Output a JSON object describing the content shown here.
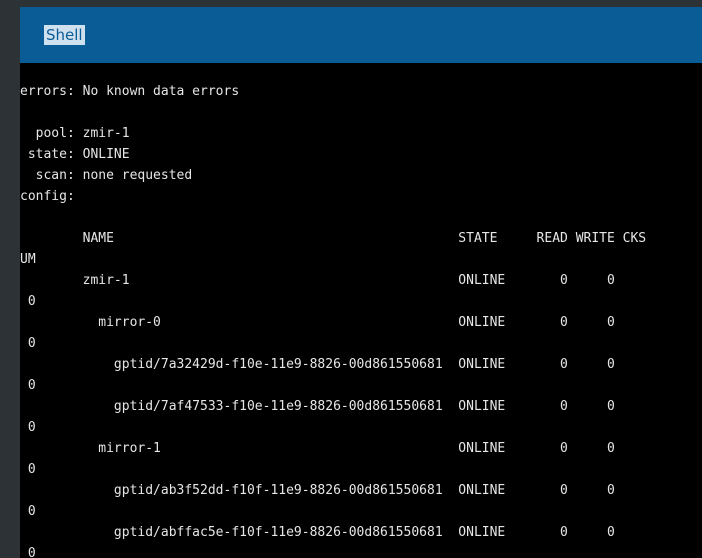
{
  "header": {
    "title": "Shell"
  },
  "terminal": {
    "lines": [
      "errors: No known data errors",
      "",
      "  pool: zmir-1",
      " state: ONLINE",
      "  scan: none requested",
      "config:",
      "",
      "        NAME                                            STATE     READ WRITE CKS",
      "UM",
      "        zmir-1                                          ONLINE       0     0",
      " 0",
      "          mirror-0                                      ONLINE       0     0",
      " 0",
      "            gptid/7a32429d-f10e-11e9-8826-00d861550681  ONLINE       0     0",
      " 0",
      "            gptid/7af47533-f10e-11e9-8826-00d861550681  ONLINE       0     0",
      " 0",
      "          mirror-1                                      ONLINE       0     0",
      " 0",
      "            gptid/ab3f52dd-f10f-11e9-8826-00d861550681  ONLINE       0     0",
      " 0",
      "            gptid/abffac5e-f10f-11e9-8826-00d861550681  ONLINE       0     0",
      " 0"
    ]
  }
}
